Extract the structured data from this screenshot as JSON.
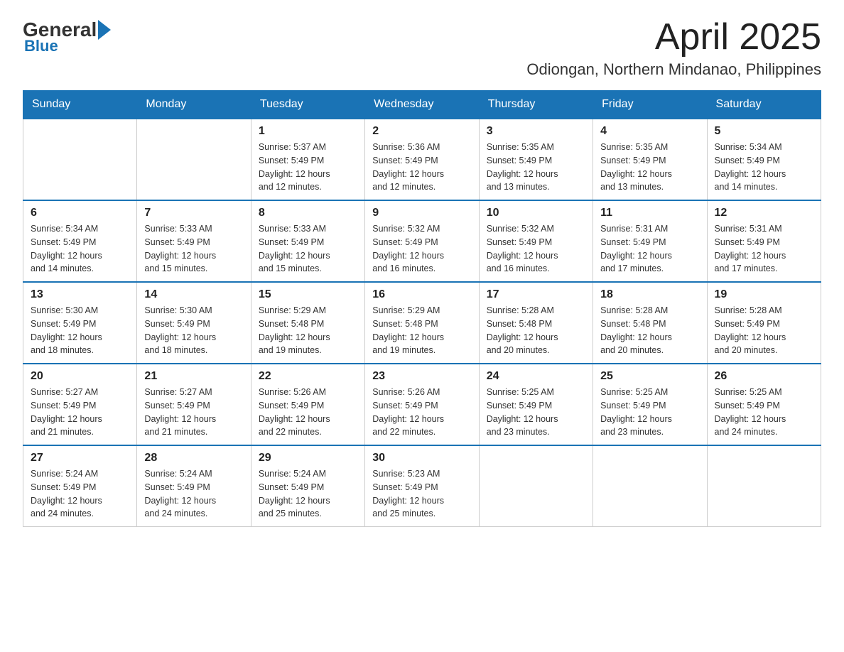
{
  "logo": {
    "general": "General",
    "blue": "Blue"
  },
  "header": {
    "month_year": "April 2025",
    "location": "Odiongan, Northern Mindanao, Philippines"
  },
  "weekdays": [
    "Sunday",
    "Monday",
    "Tuesday",
    "Wednesday",
    "Thursday",
    "Friday",
    "Saturday"
  ],
  "weeks": [
    [
      {
        "num": "",
        "info": ""
      },
      {
        "num": "",
        "info": ""
      },
      {
        "num": "1",
        "info": "Sunrise: 5:37 AM\nSunset: 5:49 PM\nDaylight: 12 hours\nand 12 minutes."
      },
      {
        "num": "2",
        "info": "Sunrise: 5:36 AM\nSunset: 5:49 PM\nDaylight: 12 hours\nand 12 minutes."
      },
      {
        "num": "3",
        "info": "Sunrise: 5:35 AM\nSunset: 5:49 PM\nDaylight: 12 hours\nand 13 minutes."
      },
      {
        "num": "4",
        "info": "Sunrise: 5:35 AM\nSunset: 5:49 PM\nDaylight: 12 hours\nand 13 minutes."
      },
      {
        "num": "5",
        "info": "Sunrise: 5:34 AM\nSunset: 5:49 PM\nDaylight: 12 hours\nand 14 minutes."
      }
    ],
    [
      {
        "num": "6",
        "info": "Sunrise: 5:34 AM\nSunset: 5:49 PM\nDaylight: 12 hours\nand 14 minutes."
      },
      {
        "num": "7",
        "info": "Sunrise: 5:33 AM\nSunset: 5:49 PM\nDaylight: 12 hours\nand 15 minutes."
      },
      {
        "num": "8",
        "info": "Sunrise: 5:33 AM\nSunset: 5:49 PM\nDaylight: 12 hours\nand 15 minutes."
      },
      {
        "num": "9",
        "info": "Sunrise: 5:32 AM\nSunset: 5:49 PM\nDaylight: 12 hours\nand 16 minutes."
      },
      {
        "num": "10",
        "info": "Sunrise: 5:32 AM\nSunset: 5:49 PM\nDaylight: 12 hours\nand 16 minutes."
      },
      {
        "num": "11",
        "info": "Sunrise: 5:31 AM\nSunset: 5:49 PM\nDaylight: 12 hours\nand 17 minutes."
      },
      {
        "num": "12",
        "info": "Sunrise: 5:31 AM\nSunset: 5:49 PM\nDaylight: 12 hours\nand 17 minutes."
      }
    ],
    [
      {
        "num": "13",
        "info": "Sunrise: 5:30 AM\nSunset: 5:49 PM\nDaylight: 12 hours\nand 18 minutes."
      },
      {
        "num": "14",
        "info": "Sunrise: 5:30 AM\nSunset: 5:49 PM\nDaylight: 12 hours\nand 18 minutes."
      },
      {
        "num": "15",
        "info": "Sunrise: 5:29 AM\nSunset: 5:48 PM\nDaylight: 12 hours\nand 19 minutes."
      },
      {
        "num": "16",
        "info": "Sunrise: 5:29 AM\nSunset: 5:48 PM\nDaylight: 12 hours\nand 19 minutes."
      },
      {
        "num": "17",
        "info": "Sunrise: 5:28 AM\nSunset: 5:48 PM\nDaylight: 12 hours\nand 20 minutes."
      },
      {
        "num": "18",
        "info": "Sunrise: 5:28 AM\nSunset: 5:48 PM\nDaylight: 12 hours\nand 20 minutes."
      },
      {
        "num": "19",
        "info": "Sunrise: 5:28 AM\nSunset: 5:49 PM\nDaylight: 12 hours\nand 20 minutes."
      }
    ],
    [
      {
        "num": "20",
        "info": "Sunrise: 5:27 AM\nSunset: 5:49 PM\nDaylight: 12 hours\nand 21 minutes."
      },
      {
        "num": "21",
        "info": "Sunrise: 5:27 AM\nSunset: 5:49 PM\nDaylight: 12 hours\nand 21 minutes."
      },
      {
        "num": "22",
        "info": "Sunrise: 5:26 AM\nSunset: 5:49 PM\nDaylight: 12 hours\nand 22 minutes."
      },
      {
        "num": "23",
        "info": "Sunrise: 5:26 AM\nSunset: 5:49 PM\nDaylight: 12 hours\nand 22 minutes."
      },
      {
        "num": "24",
        "info": "Sunrise: 5:25 AM\nSunset: 5:49 PM\nDaylight: 12 hours\nand 23 minutes."
      },
      {
        "num": "25",
        "info": "Sunrise: 5:25 AM\nSunset: 5:49 PM\nDaylight: 12 hours\nand 23 minutes."
      },
      {
        "num": "26",
        "info": "Sunrise: 5:25 AM\nSunset: 5:49 PM\nDaylight: 12 hours\nand 24 minutes."
      }
    ],
    [
      {
        "num": "27",
        "info": "Sunrise: 5:24 AM\nSunset: 5:49 PM\nDaylight: 12 hours\nand 24 minutes."
      },
      {
        "num": "28",
        "info": "Sunrise: 5:24 AM\nSunset: 5:49 PM\nDaylight: 12 hours\nand 24 minutes."
      },
      {
        "num": "29",
        "info": "Sunrise: 5:24 AM\nSunset: 5:49 PM\nDaylight: 12 hours\nand 25 minutes."
      },
      {
        "num": "30",
        "info": "Sunrise: 5:23 AM\nSunset: 5:49 PM\nDaylight: 12 hours\nand 25 minutes."
      },
      {
        "num": "",
        "info": ""
      },
      {
        "num": "",
        "info": ""
      },
      {
        "num": "",
        "info": ""
      }
    ]
  ]
}
